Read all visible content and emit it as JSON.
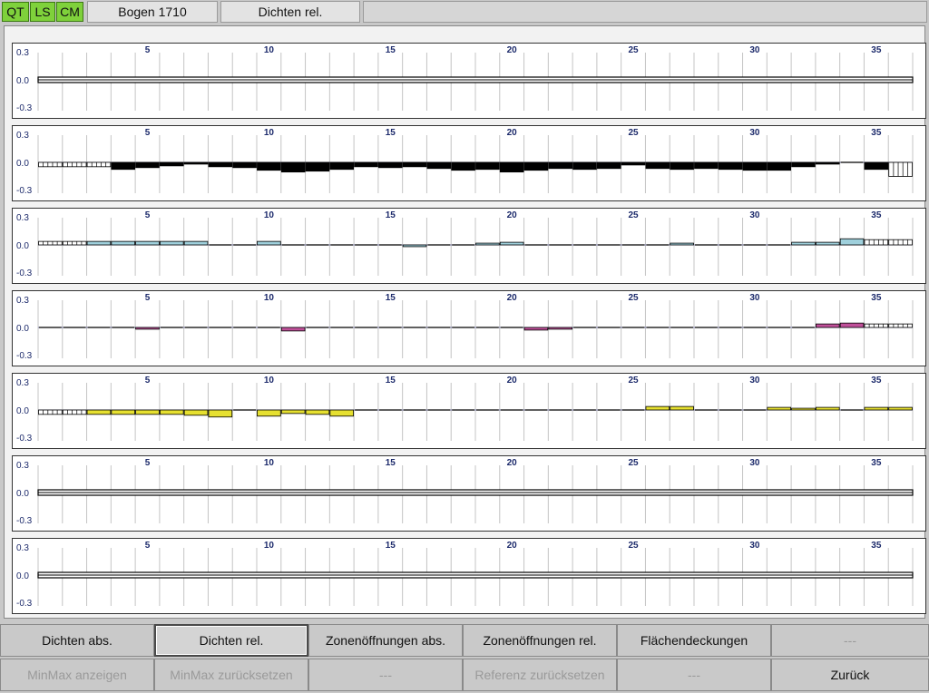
{
  "header": {
    "badges": [
      "QT",
      "LS",
      "CM"
    ],
    "tabs": [
      "Bogen 1710",
      "Dichten rel."
    ]
  },
  "chart_data": {
    "type": "bar",
    "zones": 36,
    "ylim": [
      -0.3,
      0.3
    ],
    "y_ticks": [
      "0.3",
      "0.0",
      "-0.3"
    ],
    "x_tick_labels": [
      "5",
      "10",
      "15",
      "20",
      "25",
      "30",
      "35"
    ],
    "x_tick_positions": [
      5,
      10,
      15,
      20,
      25,
      30,
      35
    ],
    "panels": [
      {
        "name": "panel-1",
        "color": "#000000",
        "values": [
          0,
          0,
          0,
          0,
          0,
          0,
          0,
          0,
          0,
          0,
          0,
          0,
          0,
          0,
          0,
          0,
          0,
          0,
          0,
          0,
          0,
          0,
          0,
          0,
          0,
          0,
          0,
          0,
          0,
          0,
          0,
          0,
          0,
          0,
          0,
          0
        ],
        "hatched": []
      },
      {
        "name": "panel-2",
        "color": "#000000",
        "values": [
          -0.05,
          -0.05,
          -0.05,
          -0.08,
          -0.06,
          -0.04,
          -0.02,
          -0.05,
          -0.06,
          -0.09,
          -0.11,
          -0.1,
          -0.08,
          -0.05,
          -0.06,
          -0.05,
          -0.07,
          -0.09,
          -0.08,
          -0.11,
          -0.09,
          -0.07,
          -0.08,
          -0.07,
          -0.03,
          -0.07,
          -0.08,
          -0.07,
          -0.08,
          -0.09,
          -0.09,
          -0.05,
          -0.02,
          -0.01,
          -0.08,
          -0.16,
          -0.16
        ],
        "hatched": [
          0,
          1,
          2,
          35,
          36
        ]
      },
      {
        "name": "panel-3",
        "color": "#9fd0dc",
        "values": [
          0.04,
          0.04,
          0.04,
          0.04,
          0.04,
          0.04,
          0.04,
          0.0,
          0.01,
          0.04,
          0.0,
          0.0,
          0.0,
          0.0,
          0.01,
          -0.02,
          0.0,
          0.0,
          0.02,
          0.03,
          0.01,
          -0.01,
          -0.01,
          0.0,
          0.01,
          0.0,
          0.02,
          0.01,
          0.0,
          0.0,
          0.0,
          0.03,
          0.03,
          0.07,
          0.06,
          0.06,
          0.06
        ],
        "hatched": [
          0,
          1,
          34,
          35,
          36
        ]
      },
      {
        "name": "panel-4",
        "color": "#c0509a",
        "values": [
          -0.01,
          -0.01,
          -0.01,
          -0.01,
          -0.02,
          -0.01,
          0.0,
          0.01,
          0.0,
          0.0,
          -0.04,
          0.0,
          0.0,
          0.0,
          0.0,
          -0.01,
          -0.01,
          0.0,
          0.01,
          0.0,
          -0.03,
          -0.02,
          -0.01,
          0.0,
          0.0,
          0.0,
          0.0,
          0.0,
          -0.01,
          0.01,
          0.0,
          -0.01,
          0.04,
          0.05,
          0.04,
          0.04,
          0.04
        ],
        "hatched": [
          34,
          35,
          36
        ]
      },
      {
        "name": "panel-5",
        "color": "#e6e030",
        "values": [
          -0.05,
          -0.05,
          -0.05,
          -0.05,
          -0.05,
          -0.05,
          -0.06,
          -0.08,
          0.0,
          -0.07,
          -0.04,
          -0.05,
          -0.07,
          0.0,
          0.0,
          0.01,
          0.0,
          0.0,
          0.01,
          -0.01,
          0.0,
          0.0,
          0.0,
          0.0,
          0.0,
          0.04,
          0.04,
          0.0,
          0.0,
          0.0,
          0.03,
          0.02,
          0.03,
          0.0,
          0.03,
          0.03,
          0.03
        ],
        "hatched": [
          0,
          1,
          36
        ]
      },
      {
        "name": "panel-6",
        "color": "#000000",
        "values": [
          0,
          0,
          0,
          0,
          0,
          0,
          0,
          0,
          0,
          0,
          0,
          0,
          0,
          0,
          0,
          0,
          0,
          0,
          0,
          0,
          0,
          0,
          0,
          0,
          0,
          0,
          0,
          0,
          0,
          0,
          0,
          0,
          0,
          0,
          0,
          0
        ],
        "hatched": []
      },
      {
        "name": "panel-7",
        "color": "#000000",
        "values": [
          0,
          0,
          0,
          0,
          0,
          0,
          0,
          0,
          0,
          0,
          0,
          0,
          0,
          0,
          0,
          0,
          0,
          0,
          0,
          0,
          0,
          0,
          0,
          0,
          0,
          0,
          0,
          0,
          0,
          0,
          0,
          0,
          0,
          0,
          0,
          0
        ],
        "hatched": []
      }
    ]
  },
  "buttons": {
    "row1": [
      {
        "name": "dichten-abs-button",
        "label": "Dichten abs.",
        "state": "normal"
      },
      {
        "name": "dichten-rel-button",
        "label": "Dichten rel.",
        "state": "active"
      },
      {
        "name": "zonenoeffnungen-abs-button",
        "label": "Zonenöffnungen abs.",
        "state": "normal"
      },
      {
        "name": "zonenoeffnungen-rel-button",
        "label": "Zonenöffnungen rel.",
        "state": "normal"
      },
      {
        "name": "flaechendeckungen-button",
        "label": "Flächendeckungen",
        "state": "normal"
      },
      {
        "name": "empty-button-1",
        "label": "---",
        "state": "disabled"
      }
    ],
    "row2": [
      {
        "name": "minmax-anzeigen-button",
        "label": "MinMax anzeigen",
        "state": "disabled"
      },
      {
        "name": "minmax-zuruecksetzen-button",
        "label": "MinMax zurücksetzen",
        "state": "disabled"
      },
      {
        "name": "empty-button-2",
        "label": "---",
        "state": "disabled"
      },
      {
        "name": "referenz-zuruecksetzen-button",
        "label": "Referenz zurücksetzen",
        "state": "disabled"
      },
      {
        "name": "empty-button-3",
        "label": "---",
        "state": "disabled"
      },
      {
        "name": "zurueck-button",
        "label": "Zurück",
        "state": "normal"
      }
    ]
  }
}
